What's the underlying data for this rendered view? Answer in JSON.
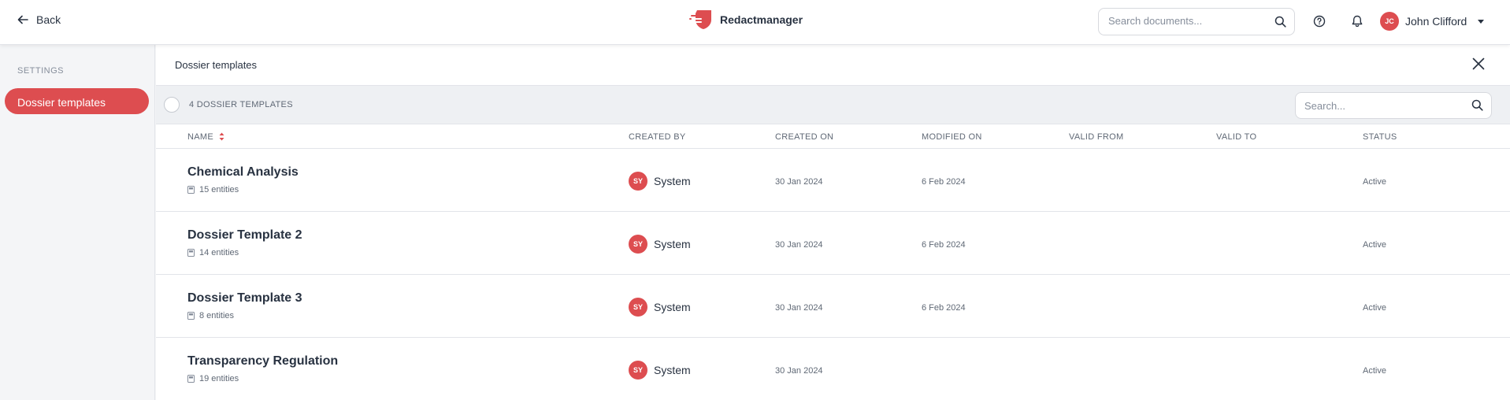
{
  "topbar": {
    "back_label": "Back",
    "brand_name": "Redactmanager",
    "search_placeholder": "Search documents...",
    "user": {
      "initials": "JC",
      "name": "John Clifford"
    }
  },
  "sidebar": {
    "heading": "SETTINGS",
    "items": [
      {
        "label": "Dossier templates",
        "active": true
      }
    ]
  },
  "page": {
    "title": "Dossier templates",
    "count_label": "4 DOSSIER TEMPLATES",
    "search_placeholder": "Search..."
  },
  "table": {
    "columns": [
      "NAME",
      "CREATED BY",
      "CREATED ON",
      "MODIFIED ON",
      "VALID FROM",
      "VALID TO",
      "STATUS"
    ],
    "rows": [
      {
        "name": "Chemical Analysis",
        "entities": "15 entities",
        "creator_initials": "SY",
        "creator": "System",
        "created_on": "30 Jan 2024",
        "modified_on": "6 Feb 2024",
        "valid_from": "",
        "valid_to": "",
        "status": "Active"
      },
      {
        "name": "Dossier Template 2",
        "entities": "14 entities",
        "creator_initials": "SY",
        "creator": "System",
        "created_on": "30 Jan 2024",
        "modified_on": "6 Feb 2024",
        "valid_from": "",
        "valid_to": "",
        "status": "Active"
      },
      {
        "name": "Dossier Template 3",
        "entities": "8 entities",
        "creator_initials": "SY",
        "creator": "System",
        "created_on": "30 Jan 2024",
        "modified_on": "6 Feb 2024",
        "valid_from": "",
        "valid_to": "",
        "status": "Active"
      },
      {
        "name": "Transparency Regulation",
        "entities": "19 entities",
        "creator_initials": "SY",
        "creator": "System",
        "created_on": "30 Jan 2024",
        "modified_on": "",
        "valid_from": "",
        "valid_to": "",
        "status": "Active"
      }
    ]
  },
  "colors": {
    "accent": "#dd4d50",
    "text": "#283241",
    "muted": "#5f6875",
    "toolbar_bg": "#eef0f3"
  }
}
